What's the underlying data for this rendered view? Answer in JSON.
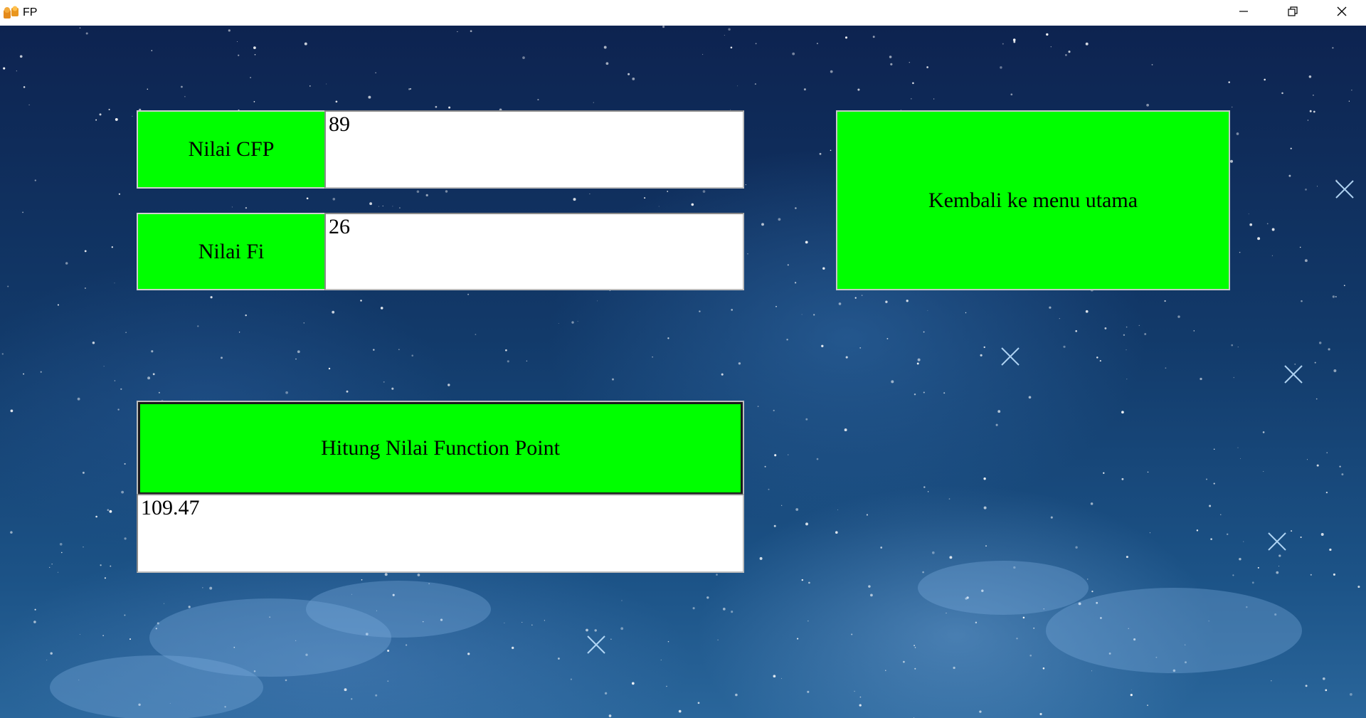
{
  "window": {
    "title": "FP",
    "icons": {
      "app": "app-icon",
      "minimize": "minimize-icon",
      "restore": "restore-icon",
      "close": "close-icon"
    }
  },
  "form": {
    "cfp_label": "Nilai CFP",
    "cfp_value": "89",
    "fi_label": "Nilai Fi",
    "fi_value": "26",
    "calculate_button": "Hitung Nilai Function Point",
    "result_value": "109.47",
    "back_button": "Kembali ke menu utama"
  },
  "colors": {
    "button_green": "#00ff00",
    "field_white": "#ffffff",
    "sky_dark": "#0d2350",
    "sky_light": "#2a669b"
  }
}
